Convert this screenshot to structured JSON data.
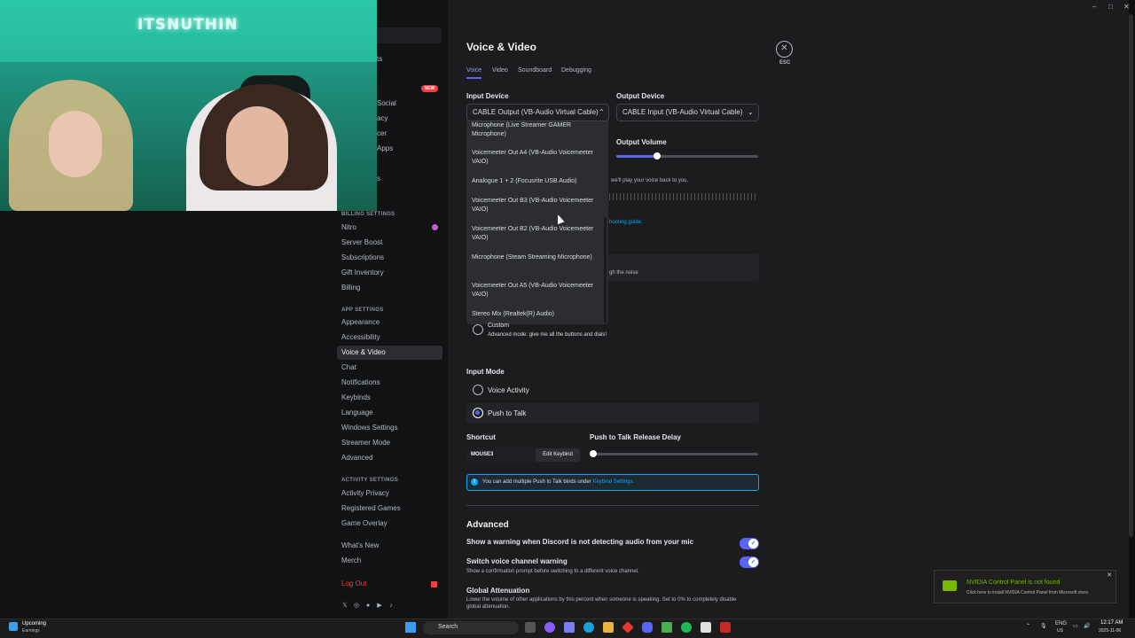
{
  "window": {
    "min": "–",
    "max": "□",
    "close": "✕"
  },
  "sidebar": {
    "partial_items": [
      "ts",
      "Social",
      "acy",
      "cer",
      "Apps",
      "s"
    ],
    "new_badge": "NEW",
    "billing_header": "BILLING SETTINGS",
    "billing_items": [
      "Nitro",
      "Server Boost",
      "Subscriptions",
      "Gift Inventory",
      "Billing"
    ],
    "app_header": "APP SETTINGS",
    "app_items": [
      "Appearance",
      "Accessibility",
      "Voice & Video",
      "Chat",
      "Notifications",
      "Keybinds",
      "Language",
      "Windows Settings",
      "Streamer Mode",
      "Advanced"
    ],
    "activity_header": "ACTIVITY SETTINGS",
    "activity_items": [
      "Activity Privacy",
      "Registered Games",
      "Game Overlay"
    ],
    "misc_items": [
      "What's New",
      "Merch"
    ],
    "logout": "Log Out",
    "social_icons": [
      "x-icon",
      "instagram-icon",
      "facebook-icon",
      "youtube-icon",
      "tiktok-icon"
    ]
  },
  "webcam": {
    "neon_sign": "ITSNUTHIN"
  },
  "main": {
    "title": "Voice & Video",
    "esc_label": "ESC",
    "tabs": [
      "Voice",
      "Video",
      "Soundboard",
      "Debugging"
    ],
    "input_device_label": "Input Device",
    "input_device_value": "CABLE Output (VB-Audio Virtual Cable)",
    "output_device_label": "Output Device",
    "output_device_value": "CABLE Input (VB-Audio Virtual Cable)",
    "output_volume_label": "Output Volume",
    "output_volume_level": 0.29,
    "mic_test_fragment": "we'll play your voice back to you.",
    "troubleshoot_fragment": "hooting guide.",
    "noise_fragment": "gh the noise",
    "dropdown_options": [
      "Microphone (Live Streamer GAMER Microphone)",
      "Voicemeeter Out A4 (VB-Audio Voicemeeter VAIO)",
      "Analogue 1 + 2 (Focusrite USB Audio)",
      "Voicemeeter Out B3 (VB-Audio Voicemeeter VAIO)",
      "Voicemeeter Out B2 (VB-Audio Voicemeeter VAIO)",
      "Microphone (Steam Streaming Microphone)",
      "Voicemeeter Out A5 (VB-Audio Voicemeeter VAIO)",
      "Stereo Mix (Realtek(R) Audio)"
    ],
    "custom_label": "Custom",
    "custom_desc": "Advanced mode: give me all the buttons and dials!",
    "input_mode_label": "Input Mode",
    "voice_activity": "Voice Activity",
    "push_to_talk": "Push to Talk",
    "shortcut_label": "Shortcut",
    "shortcut_value": "MOUSE3",
    "edit_keybind": "Edit Keybind",
    "ptt_delay_label": "Push to Talk Release Delay",
    "ptt_delay_level": 0.0,
    "info_text": "You can add multiple Push to Talk binds under",
    "info_link": "Keybind Settings.",
    "advanced_title": "Advanced",
    "warn_label": "Show a warning when Discord is not detecting audio from your mic",
    "switch_warn_label": "Switch voice channel warning",
    "switch_warn_desc": "Show a confirmation prompt before switching to a different voice channel.",
    "global_atten_label": "Global Attenuation",
    "global_atten_desc": "Lower the volume of other applications by this percent when someone is speaking. Set to 0% to completely disable global attenuation."
  },
  "toast": {
    "title": "NVIDIA Control Panel is not found",
    "subtitle": "Click here to install NVIDIA Control Panel from Microsoft store."
  },
  "taskbar": {
    "weather_title": "Upcoming",
    "weather_sub": "Earnings",
    "search_placeholder": "Search",
    "lang": "ENG",
    "region": "US",
    "time": "12:17 AM",
    "date": "2025-11-06"
  }
}
